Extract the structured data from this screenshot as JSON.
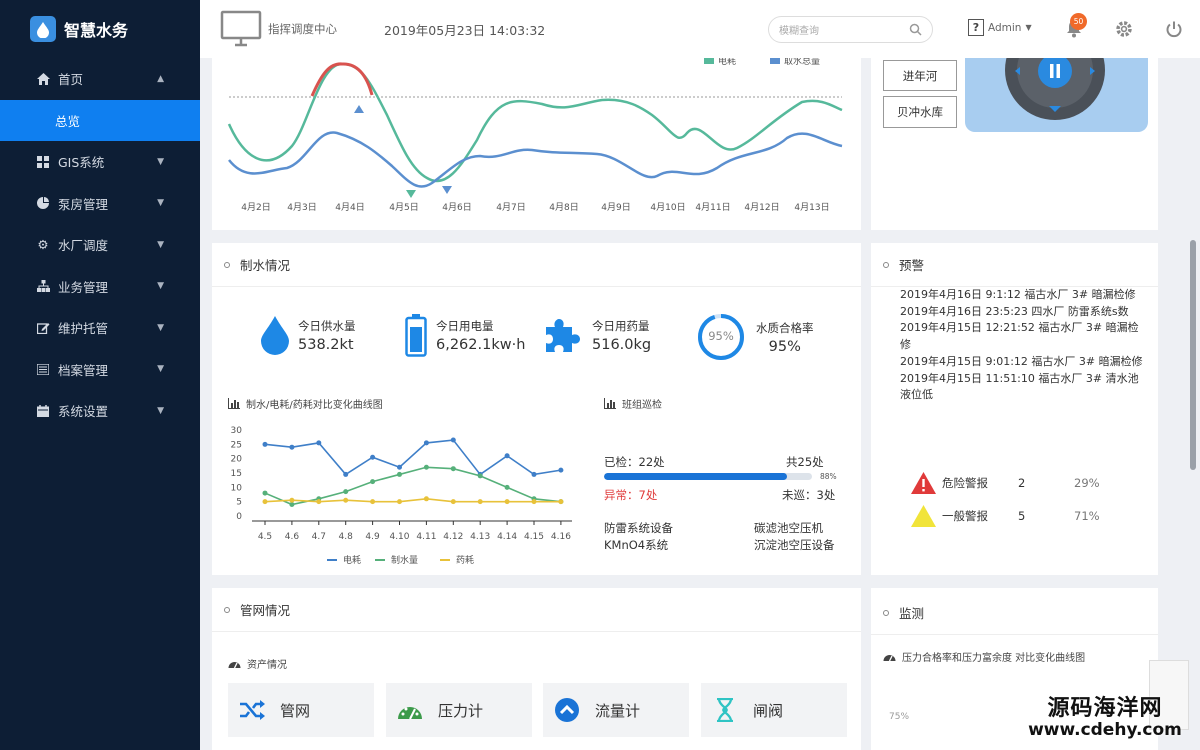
{
  "app": {
    "title": "智慧水务"
  },
  "sidebar": {
    "items": [
      {
        "label": "首页",
        "icon": "home-icon",
        "expanded": true
      },
      {
        "label": "总览",
        "icon": "",
        "active": true
      },
      {
        "label": "GIS系统",
        "icon": "grid-icon"
      },
      {
        "label": "泵房管理",
        "icon": "pie-icon"
      },
      {
        "label": "水厂调度",
        "icon": "gear-icon"
      },
      {
        "label": "业务管理",
        "icon": "sitemap-icon"
      },
      {
        "label": "维护托管",
        "icon": "edit-icon"
      },
      {
        "label": "档案管理",
        "icon": "list-icon"
      },
      {
        "label": "系统设置",
        "icon": "calendar-icon"
      }
    ]
  },
  "header": {
    "center_title": "指挥调度中心",
    "datetime": "2019年05月23日 14:03:32",
    "search_placeholder": "模糊查询",
    "user": "Admin",
    "notifications": "50"
  },
  "top_chart": {
    "legend": [
      "电耗",
      "取水总量"
    ],
    "x_labels": [
      "4月2日",
      "4月3日",
      "4月4日",
      "4月5日",
      "4月6日",
      "4月7日",
      "4月8日",
      "4月9日",
      "4月10日",
      "4月11日",
      "4月12日",
      "4月13日"
    ]
  },
  "reservoirs": [
    "进年河",
    "贝冲水库"
  ],
  "production": {
    "title": "制水情况",
    "stats": [
      {
        "label": "今日供水量",
        "value": "538.2kt",
        "icon": "water-drop-icon"
      },
      {
        "label": "今日用电量",
        "value": "6,262.1kw·h",
        "icon": "battery-icon"
      },
      {
        "label": "今日用药量",
        "value": "516.0kg",
        "icon": "puzzle-icon"
      },
      {
        "label": "水质合格率",
        "value": "95%",
        "icon": "ring-icon",
        "ring_text": "95%",
        "ring_value": 0.95
      }
    ],
    "chart_title": "制水/电耗/药耗对比变化曲线图",
    "patrol": {
      "title": "班组巡检",
      "checked": "已检：22处",
      "total": "共25处",
      "percent_text": "88%",
      "percent": 0.88,
      "abnormal": "异常：7处",
      "unchecked": "未巡：3处",
      "equipment": [
        "防雷系统设备",
        "碳滤池空压机",
        "KMnO4系统",
        "沉淀池空压设备"
      ]
    }
  },
  "chart_data": {
    "type": "line",
    "title": "制水/电耗/药耗对比变化曲线图",
    "categories": [
      "4.5",
      "4.6",
      "4.7",
      "4.8",
      "4.9",
      "4.10",
      "4.11",
      "4.12",
      "4.13",
      "4.14",
      "4.15",
      "4.16"
    ],
    "ylim": [
      0,
      30
    ],
    "yticks": [
      0,
      5,
      10,
      15,
      20,
      25,
      30
    ],
    "series": [
      {
        "name": "电耗",
        "color": "#3f7fc8",
        "values": [
          25,
          24,
          25.5,
          14.5,
          20.5,
          17,
          25.5,
          26.5,
          14.5,
          21,
          14.5,
          16
        ]
      },
      {
        "name": "制水量",
        "color": "#56b07a",
        "values": [
          8,
          4,
          6,
          8.5,
          12,
          14.5,
          17,
          16.5,
          14,
          10,
          6,
          5
        ]
      },
      {
        "name": "药耗",
        "color": "#e8c23a",
        "values": [
          5,
          5.5,
          5,
          5.5,
          5,
          5,
          6,
          5,
          5,
          5,
          5,
          5
        ]
      }
    ]
  },
  "warnings": {
    "title": "预警",
    "entries": [
      "2019年4月16日 9:1:12 福古水厂 3# 暗漏检修",
      "2019年4月16日 23:5:23 四水厂 防雷系统s数2019年4月15日 12:21:52 福古水厂 3# 暗漏检修",
      "2019年4月15日 9:01:12 福古水厂 3# 暗漏检修",
      "2019年4月15日 11:51:10 福古水厂 3# 清水池液位低"
    ],
    "alerts": [
      {
        "label": "危险警报",
        "count": "2",
        "pct": "29%",
        "color": "#e03a3a"
      },
      {
        "label": "一般警报",
        "count": "5",
        "pct": "71%",
        "color": "#f1e43a"
      }
    ]
  },
  "network": {
    "title": "管网情况",
    "asset_title": "资产情况",
    "tiles": [
      {
        "label": "管网",
        "icon": "shuffle-icon"
      },
      {
        "label": "压力计",
        "icon": "gauge-icon"
      },
      {
        "label": "流量计",
        "icon": "flow-icon"
      },
      {
        "label": "闸阀",
        "icon": "hourglass-icon"
      }
    ]
  },
  "monitor": {
    "title": "监测",
    "sub_title": "压力合格率和压力富余度 对比变化曲线图",
    "axis_value": "75%"
  },
  "watermark": {
    "line1": "源码海洋网",
    "line2": "www.cdehy.com"
  }
}
